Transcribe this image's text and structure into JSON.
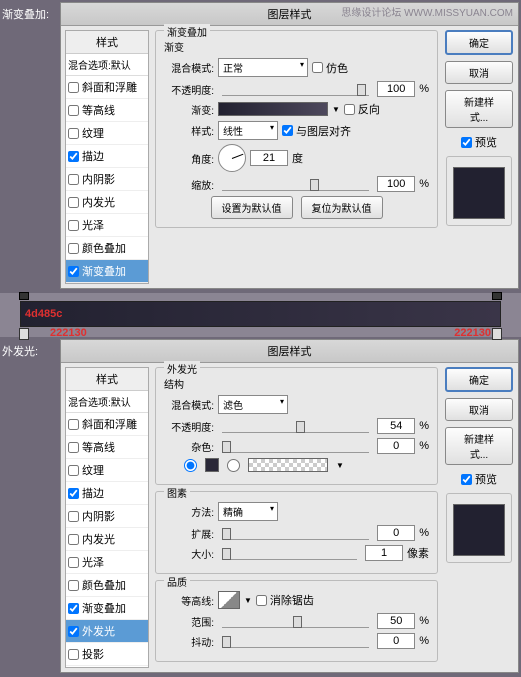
{
  "watermark": "思缘设计论坛 WWW.MISSYUAN.COM",
  "labels": {
    "grad": "渐变叠加:",
    "glow": "外发光:"
  },
  "dialog_title": "图层样式",
  "styles_header": "样式",
  "blend_default": "混合选项:默认",
  "style_items": [
    "斜面和浮雕",
    "等高线",
    "纹理",
    "描边",
    "内阴影",
    "内发光",
    "光泽",
    "颜色叠加",
    "渐变叠加",
    "外发光",
    "投影"
  ],
  "buttons": {
    "ok": "确定",
    "cancel": "取消",
    "new": "新建样式...",
    "preview": "预览",
    "set_default": "设置为默认值",
    "reset_default": "复位为默认值",
    "clear_anti": "消除锯齿"
  },
  "grad": {
    "section": "渐变叠加",
    "sub": "渐变",
    "blend_mode_label": "混合模式:",
    "blend_mode": "正常",
    "dither": "仿色",
    "opacity_label": "不透明度:",
    "opacity": "100",
    "pct": "%",
    "grad_label": "渐变:",
    "reverse": "反向",
    "style_label": "样式:",
    "style": "线性",
    "align": "与图层对齐",
    "angle_label": "角度:",
    "angle": "21",
    "deg": "度",
    "scale_label": "缩放:",
    "scale": "100"
  },
  "mid": {
    "c1": "4d485c",
    "c2": "222130",
    "c3": "222130"
  },
  "glow": {
    "section": "外发光",
    "struct": "结构",
    "blend_mode_label": "混合模式:",
    "blend_mode": "滤色",
    "opacity_label": "不透明度:",
    "opacity": "54",
    "noise_label": "杂色:",
    "noise": "0",
    "elements": "图素",
    "method_label": "方法:",
    "method": "精确",
    "spread_label": "扩展:",
    "spread": "0",
    "size_label": "大小:",
    "size": "1",
    "px": "像素",
    "quality": "品质",
    "contour_label": "等高线:",
    "range_label": "范围:",
    "range": "50",
    "jitter_label": "抖动:",
    "jitter": "0",
    "pct": "%"
  }
}
